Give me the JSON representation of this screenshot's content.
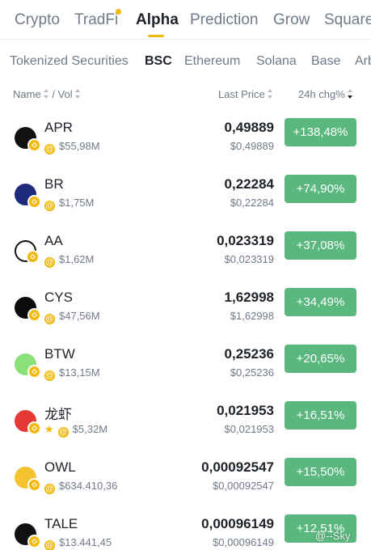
{
  "top_tabs": [
    "Crypto",
    "TradFi",
    "Alpha",
    "Prediction",
    "Grow",
    "Square"
  ],
  "chain_tabs": [
    "Tokenized Securities",
    "BSC",
    "Ethereum",
    "Solana",
    "Base",
    "Arb"
  ],
  "header": {
    "name": "Name",
    "vol": "/ Vol",
    "last_price": "Last Price",
    "change": "24h chg%"
  },
  "colors": {
    "accent": "#f0b90b",
    "positive": "#5ab77e",
    "text_primary": "#1e2329",
    "text_secondary": "#707a8a"
  },
  "rows": [
    {
      "symbol": "APR",
      "volume": "$55,98M",
      "price": "0,49889",
      "usd_price": "$0,49889",
      "change": "+138,48%",
      "icon": "apr-icon",
      "starred": false
    },
    {
      "symbol": "BR",
      "volume": "$1,75M",
      "price": "0,22284",
      "usd_price": "$0,22284",
      "change": "+74,90%",
      "icon": "br-icon",
      "starred": false
    },
    {
      "symbol": "AA",
      "volume": "$1,62M",
      "price": "0,023319",
      "usd_price": "$0,023319",
      "change": "+37,08%",
      "icon": "aa-icon",
      "starred": false
    },
    {
      "symbol": "CYS",
      "volume": "$47,56M",
      "price": "1,62998",
      "usd_price": "$1,62998",
      "change": "+34,49%",
      "icon": "cys-icon",
      "starred": false
    },
    {
      "symbol": "BTW",
      "volume": "$13,15M",
      "price": "0,25236",
      "usd_price": "$0,25236",
      "change": "+20,65%",
      "icon": "btw-icon",
      "starred": false
    },
    {
      "symbol": "龙虾",
      "volume": "$5,32M",
      "price": "0,021953",
      "usd_price": "$0,021953",
      "change": "+16,51%",
      "icon": "lobster-icon",
      "starred": true
    },
    {
      "symbol": "OWL",
      "volume": "$634.410,36",
      "price": "0,00092547",
      "usd_price": "$0,00092547",
      "change": "+15,50%",
      "icon": "owl-icon",
      "starred": false
    },
    {
      "symbol": "TALE",
      "volume": "$13.441,45",
      "price": "0,00096149",
      "usd_price": "$0,00096149",
      "change": "+12,51%",
      "icon": "tale-icon",
      "starred": false
    }
  ],
  "watermark": "@--Sky"
}
